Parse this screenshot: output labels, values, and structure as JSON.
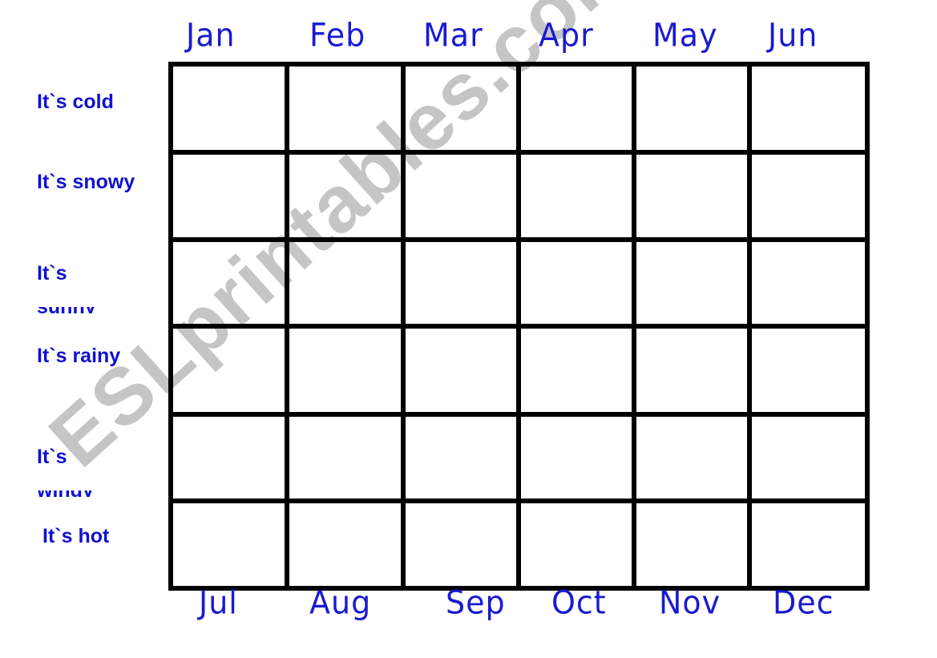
{
  "top_months": [
    "Jan",
    "Feb",
    "Mar",
    "Apr",
    "May",
    "Jun"
  ],
  "bottom_months": [
    "Jul",
    "Aug",
    "Sep",
    "Oct",
    "Nov",
    "Dec"
  ],
  "rows": [
    {
      "line1": "It`s cold",
      "line2": ""
    },
    {
      "line1": "It`s snowy",
      "line2": ""
    },
    {
      "line1": "It`s",
      "line2": "sunny"
    },
    {
      "line1": "It`s rainy",
      "line2": ""
    },
    {
      "line1": "It`s",
      "line2": "windy"
    },
    {
      "line1": "It`s hot",
      "line2": ""
    }
  ],
  "watermark": "ESLprintables.com",
  "colors": {
    "text": "#1010d0",
    "grid": "#000000",
    "watermark": "#969696"
  }
}
